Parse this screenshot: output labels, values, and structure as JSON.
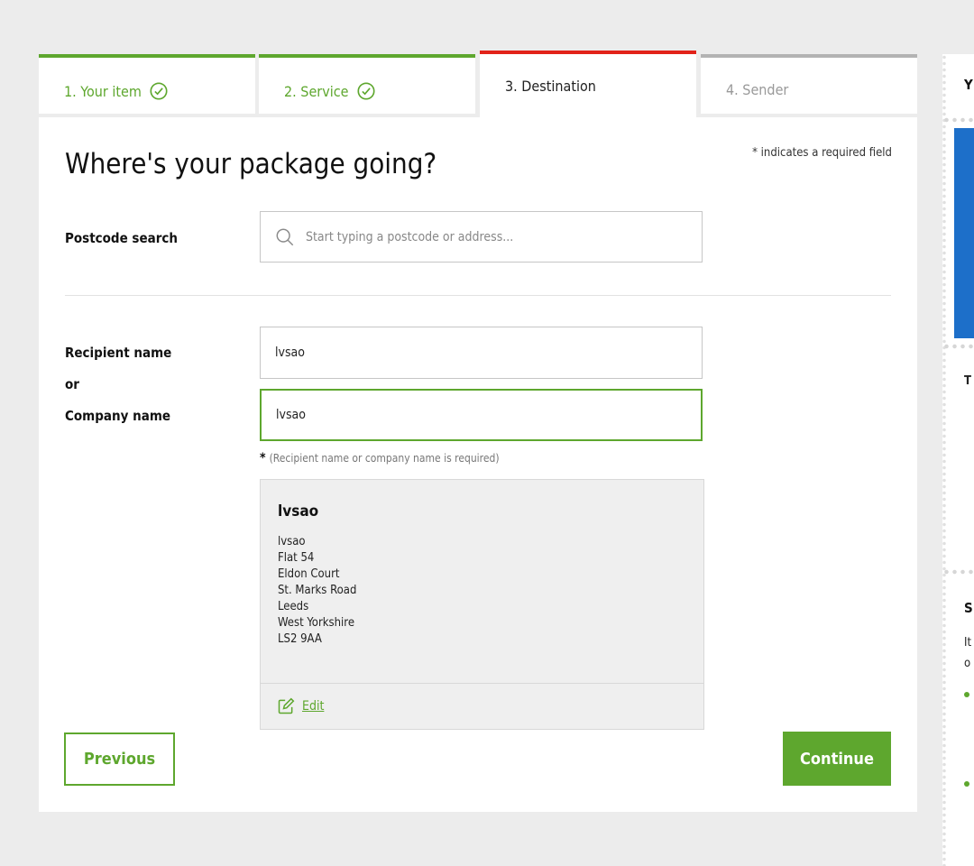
{
  "steps": [
    {
      "label": "1. Your item",
      "state": "done"
    },
    {
      "label": "2. Service",
      "state": "done"
    },
    {
      "label": "3. Destination",
      "state": "active"
    },
    {
      "label": "4. Sender",
      "state": "todo"
    }
  ],
  "page": {
    "title": "Where's your package going?",
    "required_note": "* indicates a required field"
  },
  "postcode": {
    "label": "Postcode search",
    "placeholder": "Start typing a postcode or address..."
  },
  "recipient": {
    "label_name": "Recipient name",
    "label_or": "or",
    "label_company": "Company name",
    "name_value": "lvsao",
    "company_value": "lvsao",
    "hint_star": "*",
    "hint": "(Recipient name or company name is required)"
  },
  "address": {
    "name": "lvsao",
    "lines": [
      "lvsao",
      "Flat 54",
      "Eldon Court",
      "St. Marks Road",
      "Leeds",
      "West Yorkshire",
      "LS2 9AA"
    ],
    "edit_label": "Edit"
  },
  "buttons": {
    "previous": "Previous",
    "continue": "Continue"
  },
  "sidebar": {
    "heading_fragment": "Y",
    "text_fragment_1": "T",
    "heading_fragment_2": "S",
    "text_fragment_2": "It",
    "text_fragment_3": "o"
  },
  "colors": {
    "accent": "#5ea72e",
    "active_step": "#e2231a",
    "pending_step": "#b3b3b3",
    "sidebar_image": "#1d6fc9"
  }
}
